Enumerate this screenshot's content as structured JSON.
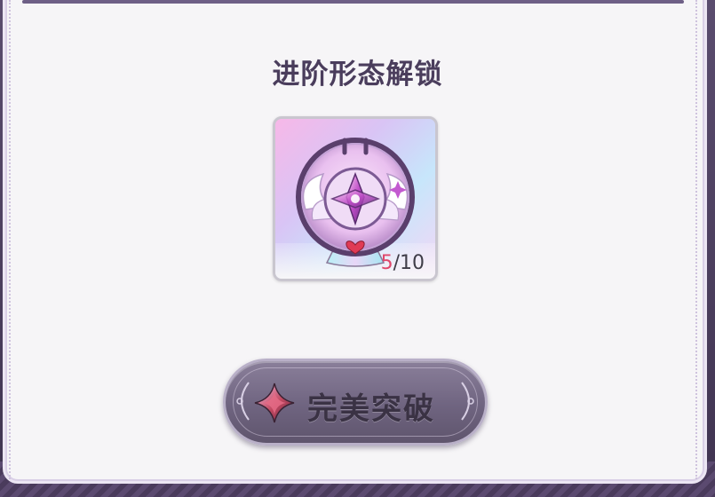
{
  "dialog": {
    "title": "进阶形态解锁"
  },
  "item": {
    "icon": "winged-crystal-emblem-icon",
    "count_current": "5",
    "count_total": "/10"
  },
  "action": {
    "label": "完美突破",
    "icon": "star-gem-icon"
  },
  "colors": {
    "title": "#4a3d5c",
    "count_current": "#e0476b",
    "button": "#6f6480",
    "panel": "#f6f5f7"
  }
}
